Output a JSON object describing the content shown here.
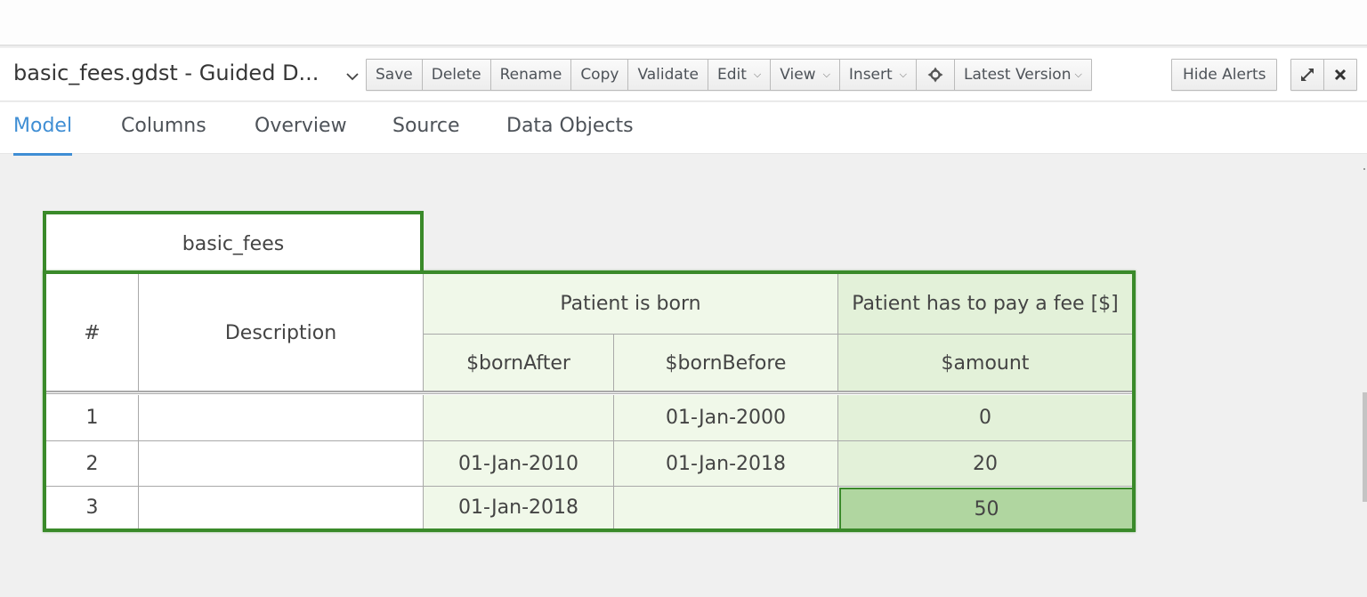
{
  "editor": {
    "title": "basic_fees.gdst - Guided D...",
    "title_menu_icon": "chevron-down-icon"
  },
  "toolbar": {
    "main_group": [
      {
        "label": "Save"
      },
      {
        "label": "Delete"
      },
      {
        "label": "Rename"
      },
      {
        "label": "Copy"
      },
      {
        "label": "Validate"
      },
      {
        "label": "Edit",
        "dropdown": true
      },
      {
        "label": "View",
        "dropdown": true
      },
      {
        "label": "Insert",
        "dropdown": true
      },
      {
        "label": "",
        "icon": "crosshair-icon"
      },
      {
        "label": "Latest Version",
        "dropdown": true
      }
    ],
    "hide_alerts": "Hide Alerts",
    "maximize_icon": "expand-icon",
    "close_icon": "close-icon",
    "caret_glyph": "⌄"
  },
  "tabs": [
    {
      "label": "Model",
      "active": true
    },
    {
      "label": "Columns",
      "active": false
    },
    {
      "label": "Overview",
      "active": false
    },
    {
      "label": "Source",
      "active": false
    },
    {
      "label": "Data Objects",
      "active": false
    }
  ],
  "decision_table": {
    "name": "basic_fees",
    "headers": {
      "row_number": "#",
      "description": "Description",
      "condition_group": "Patient is born",
      "action_group": "Patient has to pay a fee [$]",
      "columns": [
        "$bornAfter",
        "$bornBefore",
        "$amount"
      ]
    },
    "rows": [
      {
        "num": "1",
        "description": "",
        "bornAfter": "",
        "bornBefore": "01-Jan-2000",
        "amount": "0"
      },
      {
        "num": "2",
        "description": "",
        "bornAfter": "01-Jan-2010",
        "bornBefore": "01-Jan-2018",
        "amount": "20"
      },
      {
        "num": "3",
        "description": "",
        "bornAfter": "01-Jan-2018",
        "bornBefore": "",
        "amount": "50"
      }
    ],
    "selected_cell": {
      "row": 3,
      "column": "$amount"
    },
    "colors": {
      "border": "#3a8a2a",
      "condition_bg": "#f0f8e9",
      "action_bg": "#e3f1d9",
      "selected_bg": "#b0d6a0"
    }
  }
}
